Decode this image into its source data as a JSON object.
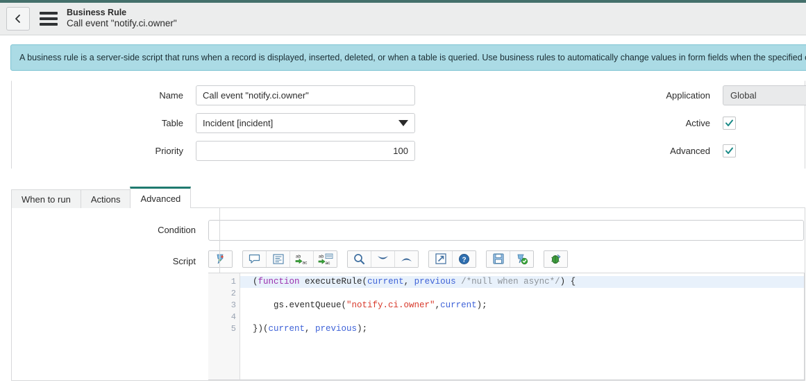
{
  "header": {
    "back_icon": "chevron-left-icon",
    "menu_icon": "hamburger-menu-icon",
    "record_type": "Business Rule",
    "record_title": "Call event \"notify.ci.owner\""
  },
  "banner": {
    "text": "A business rule is a server-side script that runs when a record is displayed, inserted, deleted, or when a table is queried. Use business rules to automatically change values in form fields when the specified conditio"
  },
  "form": {
    "left": {
      "name_label": "Name",
      "name_value": "Call event \"notify.ci.owner\"",
      "table_label": "Table",
      "table_value": "Incident [incident]",
      "priority_label": "Priority",
      "priority_value": "100"
    },
    "right": {
      "application_label": "Application",
      "application_value": "Global",
      "active_label": "Active",
      "active_checked": true,
      "advanced_label": "Advanced",
      "advanced_checked": true
    }
  },
  "tabs": [
    {
      "label": "When to run",
      "active": false
    },
    {
      "label": "Actions",
      "active": false
    },
    {
      "label": "Advanced",
      "active": true
    }
  ],
  "advanced_tab": {
    "condition_label": "Condition",
    "condition_value": "",
    "condition_placeholder": "",
    "script_label": "Script",
    "toolbar": [
      {
        "group": 1,
        "name": "script-snippet-icon"
      },
      {
        "group": 2,
        "name": "comment-icon"
      },
      {
        "group": 2,
        "name": "format-code-icon"
      },
      {
        "group": 2,
        "name": "replace-icon"
      },
      {
        "group": 2,
        "name": "replace-all-icon"
      },
      {
        "group": 3,
        "name": "search-icon"
      },
      {
        "group": 3,
        "name": "find-next-icon"
      },
      {
        "group": 3,
        "name": "find-previous-icon"
      },
      {
        "group": 4,
        "name": "fullscreen-icon"
      },
      {
        "group": 4,
        "name": "help-icon"
      },
      {
        "group": 5,
        "name": "save-icon"
      },
      {
        "group": 5,
        "name": "syntax-check-icon"
      },
      {
        "group": 6,
        "name": "debug-bug-icon"
      }
    ],
    "code": {
      "line_numbers": [
        "1",
        "2",
        "3",
        "4",
        "5"
      ],
      "lines": [
        "(function executeRule(current, previous /*null when async*/) {",
        "",
        "    gs.eventQueue(\"notify.ci.owner\",current);",
        "",
        "})(current, previous);"
      ],
      "active_line": 1
    }
  },
  "colors": {
    "accent_teal": "#1f7a6f",
    "top_strip": "#44706b",
    "banner_bg": "#abdbe5",
    "check_teal": "#1a8a87",
    "active_line": "#e8f1fb",
    "keyword": "#9b2fae",
    "variable": "#3f63d8",
    "string": "#d8392b",
    "comment": "#8d9399"
  }
}
